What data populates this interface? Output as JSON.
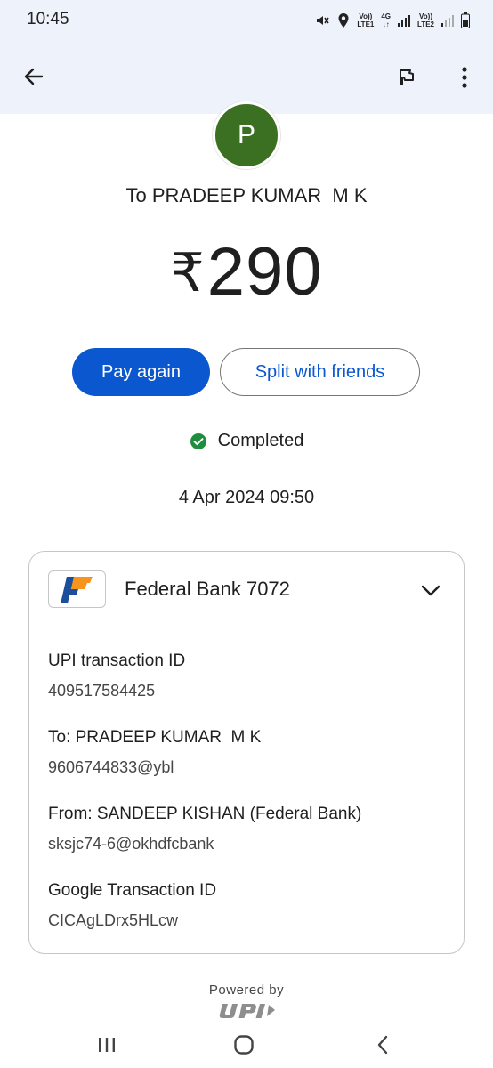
{
  "status_bar": {
    "time": "10:45",
    "sim1": {
      "top": "Vo))",
      "bottom": "LTE1"
    },
    "net": {
      "top": "4G",
      "bottom": "↓↑"
    },
    "sim2": {
      "top": "Vo))",
      "bottom": "LTE2"
    }
  },
  "app_bar": {
    "icons": {
      "back": "arrow-back-icon",
      "report": "flag-icon",
      "menu": "more-vert-icon"
    }
  },
  "payee": {
    "avatar_letter": "P",
    "avatar_color": "#3b7022",
    "name": "To PRADEEP KUMAR  M K"
  },
  "amount": {
    "currency": "₹",
    "value": "290"
  },
  "actions": {
    "pay_again": "Pay again",
    "split": "Split with friends",
    "primary_color": "#0b57d0"
  },
  "transaction_status": {
    "text": "Completed",
    "color": "#1e8e3e"
  },
  "datetime": "4 Apr 2024 09:50",
  "card": {
    "bank_name": "Federal Bank 7072",
    "details": [
      {
        "label": "UPI transaction ID",
        "value": "409517584425"
      },
      {
        "label": "To: PRADEEP KUMAR  M K",
        "value": "9606744833@ybl"
      },
      {
        "label": "From: SANDEEP KISHAN (Federal Bank)",
        "value": "sksjc74-6@okhdfcbank"
      },
      {
        "label": "Google Transaction ID",
        "value": "CICAgLDrx5HLcw"
      }
    ]
  },
  "footer": {
    "powered_by": "Powered by",
    "logo": "UPI"
  }
}
